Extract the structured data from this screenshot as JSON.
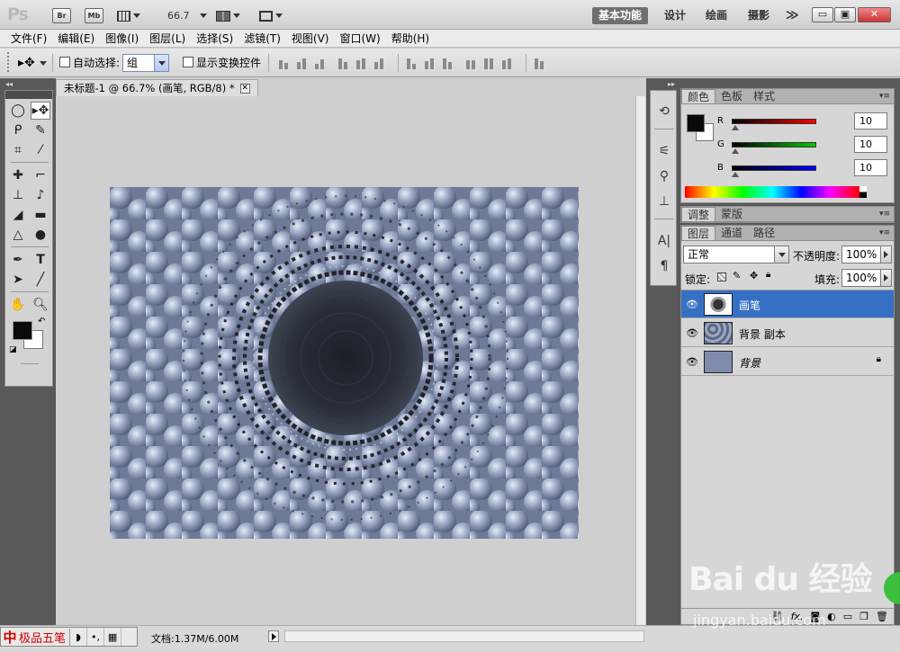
{
  "appbar": {
    "logo": "Ps",
    "bridge_label": "Br",
    "minibridge_label": "Mb",
    "zoom_value": "66.7",
    "workspaces": [
      "基本功能",
      "设计",
      "绘画",
      "摄影"
    ],
    "more_label": "≫",
    "window_buttons": {
      "min": "▭",
      "restore": "▣",
      "close": "✕"
    }
  },
  "menu": [
    "文件(F)",
    "编辑(E)",
    "图像(I)",
    "图层(L)",
    "选择(S)",
    "滤镜(T)",
    "视图(V)",
    "窗口(W)",
    "帮助(H)"
  ],
  "options": {
    "auto_select_label": "自动选择:",
    "auto_select_value": "组",
    "show_transform_label": "显示变换控件"
  },
  "document": {
    "tab_title": "未标题-1 @ 66.7% (画笔, RGB/8) *",
    "status_size": "文档:1.37M/6.00M"
  },
  "ime": {
    "zh": "中",
    "name": "极品五笔",
    "icons": [
      "◗",
      "•,",
      "▦"
    ]
  },
  "color_panel": {
    "tabs": [
      "颜色",
      "色板",
      "样式"
    ],
    "labels": [
      "R",
      "G",
      "B"
    ],
    "values": [
      "10",
      "10",
      "10"
    ],
    "accent_colors": {
      "r": "#ff0000",
      "g": "#00cc00",
      "b": "#0000ff"
    }
  },
  "adjust_panel": {
    "tabs": [
      "调整",
      "蒙版"
    ]
  },
  "layers_panel": {
    "tabs": [
      "图层",
      "通道",
      "路径"
    ],
    "blend_mode": "正常",
    "opacity_label": "不透明度:",
    "opacity_value": "100%",
    "lock_label": "锁定:",
    "fill_label": "填充:",
    "fill_value": "100%",
    "layers": [
      {
        "name": "画笔",
        "selected": true
      },
      {
        "name": "背景 副本",
        "selected": false
      },
      {
        "name": "背景",
        "selected": false,
        "locked": true
      }
    ],
    "bottom_icons": [
      "link-icon",
      "fx-icon",
      "mask-icon",
      "adjustment-icon",
      "folder-icon",
      "new-layer-icon",
      "trash-icon"
    ]
  },
  "watermark": {
    "brand": "Bai du 经验",
    "url": "jingyan.baidu.com"
  }
}
